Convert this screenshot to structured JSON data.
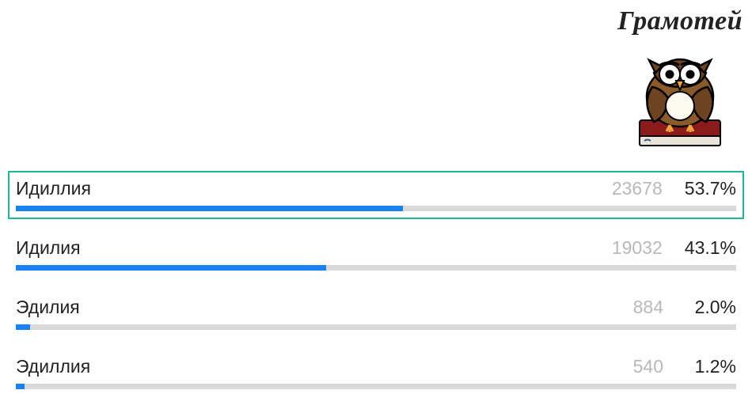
{
  "brand": {
    "title": "Грамотей"
  },
  "chart_data": {
    "type": "bar",
    "title": "",
    "xlabel": "",
    "ylabel": "",
    "categories": [
      "Идиллия",
      "Идилия",
      "Эдилия",
      "Эдиллия"
    ],
    "series": [
      {
        "name": "count",
        "values": [
          23678,
          19032,
          884,
          540
        ]
      },
      {
        "name": "percent",
        "values": [
          53.7,
          43.1,
          2.0,
          1.2
        ]
      }
    ],
    "selected_index": 0
  },
  "rows": [
    {
      "label": "Идиллия",
      "count": "23678",
      "pct": "53.7%",
      "width": "53.7%",
      "selected": true
    },
    {
      "label": "Идилия",
      "count": "19032",
      "pct": "43.1%",
      "width": "43.1%",
      "selected": false
    },
    {
      "label": "Эдилия",
      "count": "884",
      "pct": "2.0%",
      "width": "2.0%",
      "selected": false
    },
    {
      "label": "Эдиллия",
      "count": "540",
      "pct": "1.2%",
      "width": "1.2%",
      "selected": false
    }
  ]
}
